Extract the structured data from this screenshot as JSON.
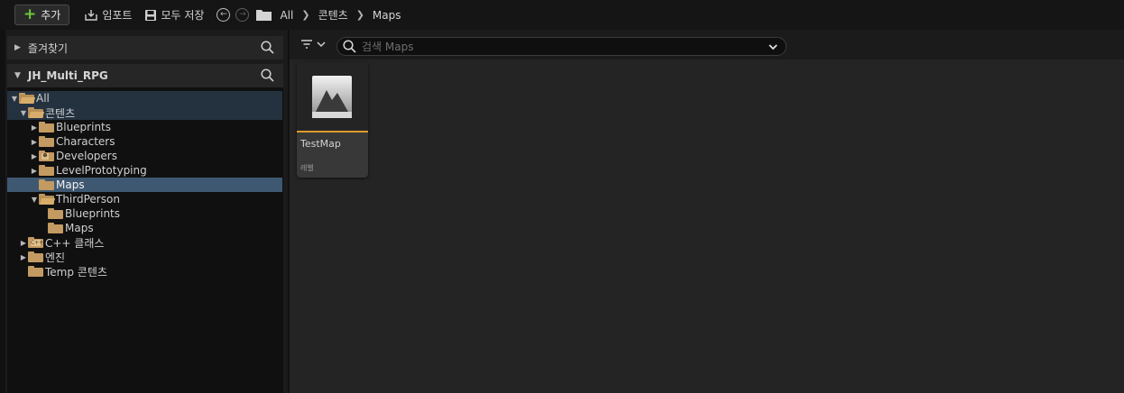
{
  "toolbar": {
    "add_label": "추가",
    "import_label": "임포트",
    "save_all_label": "모두 저장"
  },
  "breadcrumb": [
    "All",
    "콘텐츠",
    "Maps"
  ],
  "favorites": {
    "label": "즐겨찾기"
  },
  "project": {
    "label": "JH_Multi_RPG"
  },
  "tree": [
    {
      "label": "All"
    },
    {
      "label": "콘텐츠"
    },
    {
      "label": "Blueprints"
    },
    {
      "label": "Characters"
    },
    {
      "label": "Developers"
    },
    {
      "label": "LevelPrototyping"
    },
    {
      "label": "Maps"
    },
    {
      "label": "ThirdPerson"
    },
    {
      "label": "Blueprints"
    },
    {
      "label": "Maps"
    },
    {
      "label": "C++ 클래스"
    },
    {
      "label": "엔진"
    },
    {
      "label": "Temp 콘텐츠"
    }
  ],
  "search": {
    "placeholder": "검색 Maps"
  },
  "assets": [
    {
      "name": "TestMap",
      "type": "레벨"
    }
  ],
  "colors": {
    "accent_orange": "#e29a2e",
    "folder": "#c39a61",
    "selection": "#3f5872",
    "add_plus": "#6cc93a"
  }
}
